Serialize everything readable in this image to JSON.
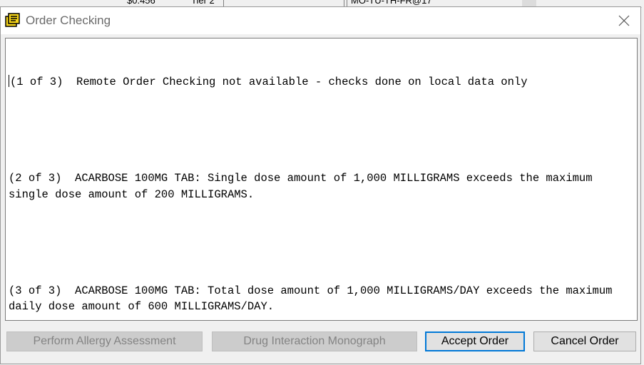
{
  "background": {
    "cells": [
      "$0.456",
      "Tier 2",
      "MO-TU-TH-FR@17"
    ]
  },
  "dialog": {
    "title": "Order Checking",
    "messages": [
      "(1 of 3)  Remote Order Checking not available - checks done on local data only",
      "(2 of 3)  ACARBOSE 100MG TAB: Single dose amount of 1,000 MILLIGRAMS exceeds the maximum single dose amount of 200 MILLIGRAMS.",
      "(3 of 3)  ACARBOSE 100MG TAB: Total dose amount of 1,000 MILLIGRAMS/DAY exceeds the maximum daily dose amount of 600 MILLIGRAMS/DAY."
    ],
    "buttons": {
      "allergy": "Perform Allergy Assessment",
      "monograph": "Drug Interaction Monograph",
      "accept": "Accept Order",
      "cancel": "Cancel Order"
    }
  },
  "colors": {
    "accent": "#0078d7",
    "disabled_text": "#838383"
  }
}
